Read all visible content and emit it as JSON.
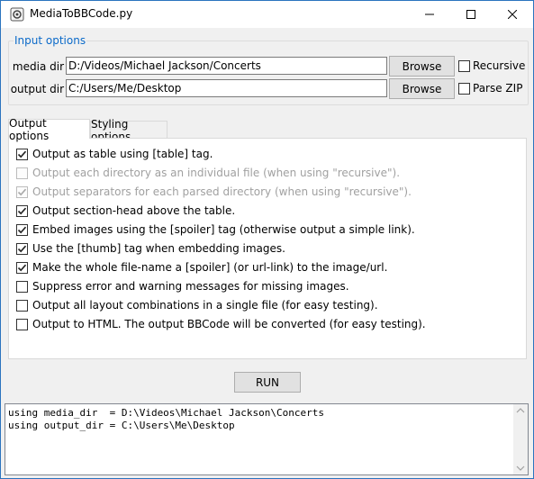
{
  "window": {
    "title": "MediaToBBCode.py"
  },
  "input_options": {
    "legend": "Input options",
    "media_dir": {
      "label": "media dir",
      "value": "D:/Videos/Michael Jackson/Concerts",
      "browse": "Browse"
    },
    "output_dir": {
      "label": "output dir",
      "value": "C:/Users/Me/Desktop",
      "browse": "Browse"
    },
    "recursive": {
      "label": "Recursive",
      "checked": false
    },
    "parse_zip": {
      "label": "Parse ZIP",
      "checked": false
    }
  },
  "tabs": [
    {
      "label": "Output options",
      "active": true
    },
    {
      "label": "Styling options",
      "active": false
    }
  ],
  "options": [
    {
      "label": "Output as table using [table] tag.",
      "checked": true,
      "disabled": false
    },
    {
      "label": "Output each directory as an individual file (when using \"recursive\").",
      "checked": false,
      "disabled": true
    },
    {
      "label": "Output separators for each parsed directory (when using \"recursive\").",
      "checked": true,
      "disabled": true
    },
    {
      "label": "Output section-head above the table.",
      "checked": true,
      "disabled": false
    },
    {
      "label": "Embed images using the [spoiler] tag (otherwise output a simple link).",
      "checked": true,
      "disabled": false
    },
    {
      "label": "Use the [thumb] tag when embedding images.",
      "checked": true,
      "disabled": false
    },
    {
      "label": "Make the whole file-name a [spoiler] (or url-link) to the image/url.",
      "checked": true,
      "disabled": false
    },
    {
      "label": "Suppress error and warning messages for missing images.",
      "checked": false,
      "disabled": false
    },
    {
      "label": "Output all layout combinations in a single file (for easy testing).",
      "checked": false,
      "disabled": false
    },
    {
      "label": "Output to HTML. The output BBCode will be converted (for easy testing).",
      "checked": false,
      "disabled": false
    }
  ],
  "run_button": "RUN",
  "output_lines": [
    "using media_dir  = D:\\Videos\\Michael Jackson\\Concerts",
    "using output_dir = C:\\Users\\Me\\Desktop"
  ]
}
